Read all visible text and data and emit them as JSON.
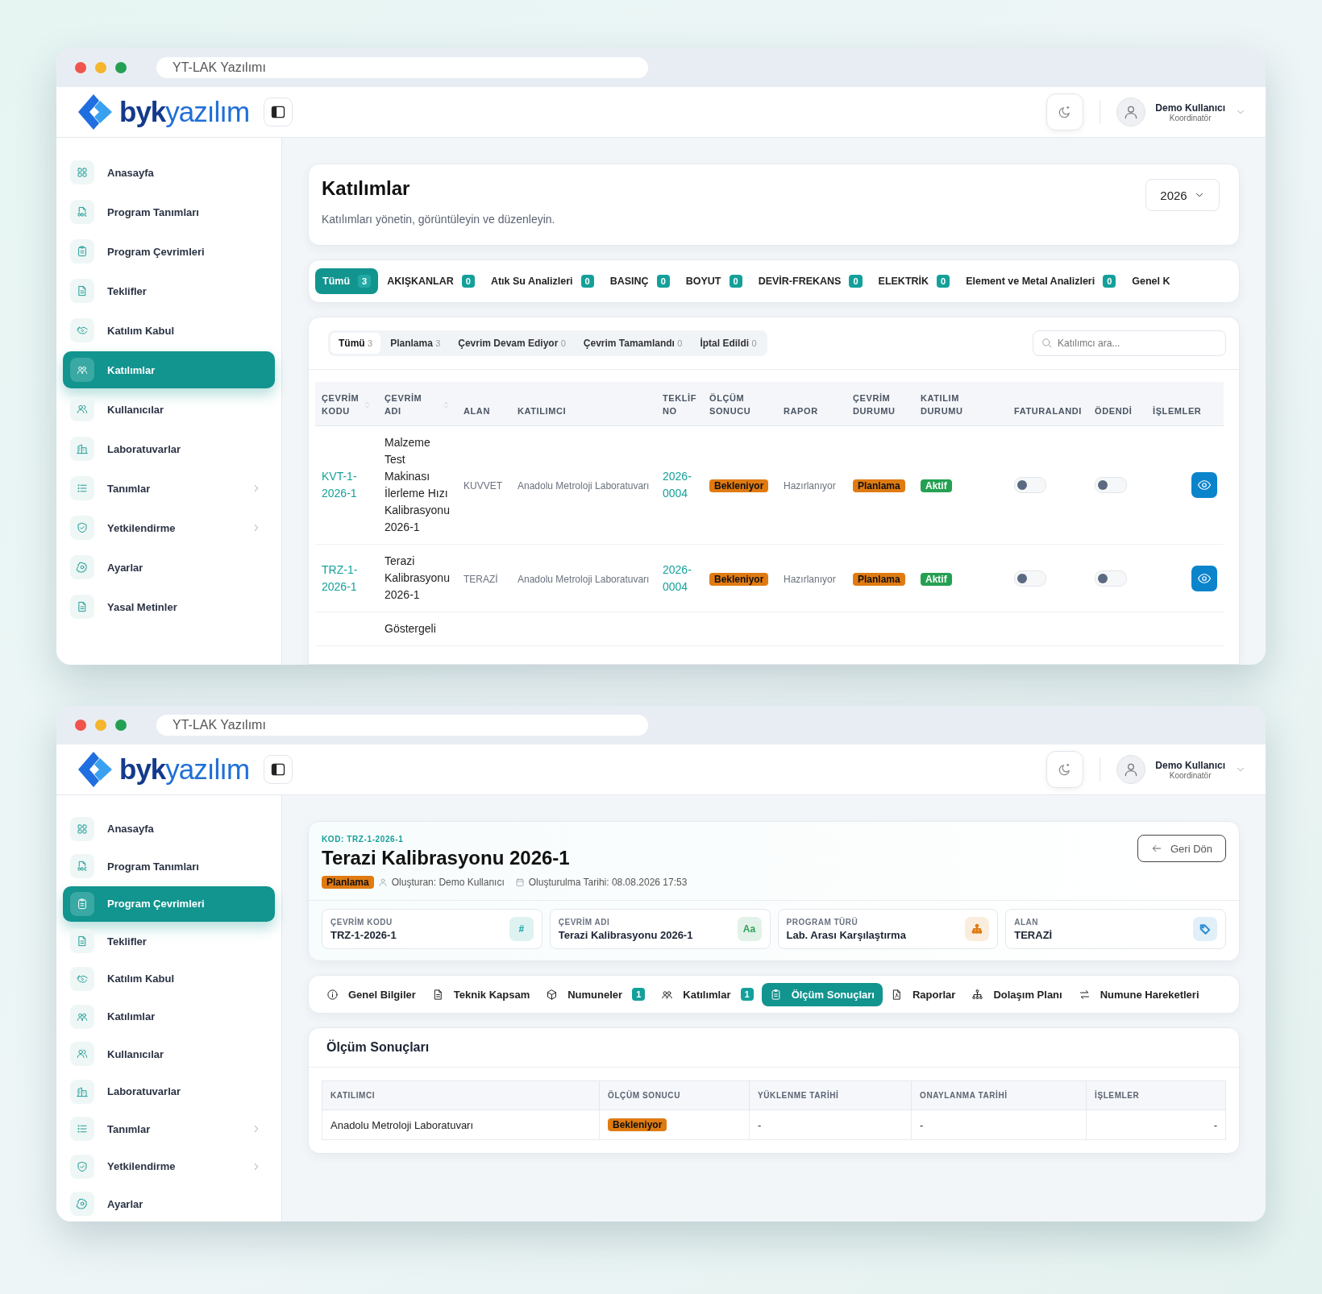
{
  "windows": [
    {
      "address": "YT-LAK Yazılımı",
      "brand": {
        "strong": "byk",
        "light": "yazılım"
      },
      "user": {
        "name": "Demo Kullanıcı",
        "role": "Koordinatör"
      },
      "sidebar": {
        "items": [
          {
            "label": "Anasayfa",
            "selected": false,
            "expandable": false
          },
          {
            "label": "Program Tanımları",
            "selected": false,
            "expandable": false
          },
          {
            "label": "Program Çevrimleri",
            "selected": false,
            "expandable": false
          },
          {
            "label": "Teklifler",
            "selected": false,
            "expandable": false
          },
          {
            "label": "Katılım Kabul",
            "selected": false,
            "expandable": false
          },
          {
            "label": "Katılımlar",
            "selected": true,
            "expandable": false
          },
          {
            "label": "Kullanıcılar",
            "selected": false,
            "expandable": false
          },
          {
            "label": "Laboratuvarlar",
            "selected": false,
            "expandable": false
          },
          {
            "label": "Tanımlar",
            "selected": false,
            "expandable": true
          },
          {
            "label": "Yetkilendirme",
            "selected": false,
            "expandable": true
          },
          {
            "label": "Ayarlar",
            "selected": false,
            "expandable": false
          },
          {
            "label": "Yasal Metinler",
            "selected": false,
            "expandable": false
          }
        ]
      },
      "page": {
        "kind": "list",
        "title": "Katılımlar",
        "subtitle": "Katılımları yönetin, görüntüleyin ve düzenleyin.",
        "year": "2026",
        "category_tabs": [
          {
            "label": "Tümü",
            "count": "3",
            "selected": true
          },
          {
            "label": "AKIŞKANLAR",
            "count": "0",
            "selected": false
          },
          {
            "label": "Atık Su Analizleri",
            "count": "0",
            "selected": false
          },
          {
            "label": "BASINÇ",
            "count": "0",
            "selected": false
          },
          {
            "label": "BOYUT",
            "count": "0",
            "selected": false
          },
          {
            "label": "DEVİR-FREKANS",
            "count": "0",
            "selected": false
          },
          {
            "label": "ELEKTRİK",
            "count": "0",
            "selected": false
          },
          {
            "label": "Element ve Metal Analizleri",
            "count": "0",
            "selected": false
          },
          {
            "label": "Genel K",
            "selected": false
          }
        ],
        "status_tabs": [
          {
            "label": "Tümü",
            "count": "3",
            "selected": true
          },
          {
            "label": "Planlama",
            "count": "3",
            "selected": false
          },
          {
            "label": "Çevrim Devam Ediyor",
            "count": "0",
            "selected": false
          },
          {
            "label": "Çevrim Tamamlandı",
            "count": "0",
            "selected": false
          },
          {
            "label": "İptal Edildi",
            "count": "0",
            "selected": false
          }
        ],
        "search": {
          "placeholder": "Katılımcı ara..."
        },
        "table": {
          "columns": [
            {
              "label": "ÇEVRİM KODU",
              "sortable": true
            },
            {
              "label": "ÇEVRİM ADI",
              "sortable": true
            },
            {
              "label": "ALAN",
              "sortable": false
            },
            {
              "label": "KATILIMCI",
              "sortable": false
            },
            {
              "label": "TEKLİF NO",
              "sortable": false
            },
            {
              "label": "ÖLÇÜM SONUCU",
              "sortable": false
            },
            {
              "label": "RAPOR",
              "sortable": false
            },
            {
              "label": "ÇEVRİM DURUMU",
              "sortable": false
            },
            {
              "label": "KATILIM DURUMU",
              "sortable": false
            },
            {
              "label": "FATURALANDI",
              "sortable": false
            },
            {
              "label": "ÖDENDİ",
              "sortable": false
            },
            {
              "label": "İŞLEMLER",
              "sortable": false
            }
          ],
          "rows": [
            {
              "code": "KVT-1-2026-1",
              "name": "Malzeme Test Makinası İlerleme Hızı Kalibrasyonu 2026-1",
              "area": "KUVVET",
              "participant": "Anadolu Metroloji Laboratuvarı",
              "offer_no": "2026-0004",
              "result": "Bekleniyor",
              "report": "Hazırlanıyor",
              "cycle_status": "Planlama",
              "participation_status": "Aktif",
              "invoiced": false,
              "paid": false
            },
            {
              "code": "TRZ-1-2026-1",
              "name": "Terazi Kalibrasyonu 2026-1",
              "area": "TERAZİ",
              "participant": "Anadolu Metroloji Laboratuvarı",
              "offer_no": "2026-0004",
              "result": "Bekleniyor",
              "report": "Hazırlanıyor",
              "cycle_status": "Planlama",
              "participation_status": "Aktif",
              "invoiced": false,
              "paid": false
            },
            {
              "name": "Göstergeli"
            }
          ]
        }
      }
    },
    {
      "address": "YT-LAK Yazılımı",
      "brand": {
        "strong": "byk",
        "light": "yazılım"
      },
      "user": {
        "name": "Demo Kullanıcı",
        "role": "Koordinatör"
      },
      "sidebar": {
        "items": [
          {
            "label": "Anasayfa",
            "selected": false,
            "expandable": false
          },
          {
            "label": "Program Tanımları",
            "selected": false,
            "expandable": false
          },
          {
            "label": "Program Çevrimleri",
            "selected": true,
            "expandable": false
          },
          {
            "label": "Teklifler",
            "selected": false,
            "expandable": false
          },
          {
            "label": "Katılım Kabul",
            "selected": false,
            "expandable": false
          },
          {
            "label": "Katılımlar",
            "selected": false,
            "expandable": false
          },
          {
            "label": "Kullanıcılar",
            "selected": false,
            "expandable": false
          },
          {
            "label": "Laboratuvarlar",
            "selected": false,
            "expandable": false
          },
          {
            "label": "Tanımlar",
            "selected": false,
            "expandable": true
          },
          {
            "label": "Yetkilendirme",
            "selected": false,
            "expandable": true
          },
          {
            "label": "Ayarlar",
            "selected": false,
            "expandable": false
          }
        ]
      },
      "page": {
        "kind": "detail",
        "code": "KOD: TRZ-1-2026-1",
        "title": "Terazi Kalibrasyonu 2026-1",
        "status": "Planlama",
        "created_by": "Oluşturan: Demo Kullanıcı",
        "created_at": "Oluşturulma Tarihi: 08.08.2026 17:53",
        "back": "Geri Dön",
        "info_cards": [
          {
            "label": "ÇEVRİM KODU",
            "value": "TRZ-1-2026-1",
            "symbol": "#",
            "color": "#1aa3a0"
          },
          {
            "label": "ÇEVRİM ADI",
            "value": "Terazi Kalibrasyonu 2026-1",
            "symbol": "Aa",
            "color": "#2fa35a"
          },
          {
            "label": "PROGRAM TÜRÜ",
            "value": "Lab. Arası Karşılaştırma",
            "color": "#e07b12"
          },
          {
            "label": "ALAN",
            "value": "TERAZİ",
            "color": "#2a8fd6"
          }
        ],
        "tabs": [
          {
            "label": "Genel Bilgiler",
            "selected": false
          },
          {
            "label": "Teknik Kapsam",
            "selected": false
          },
          {
            "label": "Numuneler",
            "count": "1",
            "selected": false
          },
          {
            "label": "Katılımlar",
            "count": "1",
            "selected": false
          },
          {
            "label": "Ölçüm Sonuçları",
            "selected": true
          },
          {
            "label": "Raporlar",
            "selected": false
          },
          {
            "label": "Dolaşım Planı",
            "selected": false
          },
          {
            "label": "Numune Hareketleri",
            "selected": false
          }
        ],
        "results": {
          "title": "Ölçüm Sonuçları",
          "columns": [
            "KATILIMCI",
            "ÖLÇÜM SONUCU",
            "YÜKLENME TARİHİ",
            "ONAYLANMA TARİHİ",
            "İŞLEMLER"
          ],
          "rows": [
            {
              "participant": "Anadolu Metroloji Laboratuvarı",
              "result": "Bekleniyor",
              "uploaded": "-",
              "approved": "-",
              "actions": "-"
            }
          ]
        }
      }
    }
  ]
}
